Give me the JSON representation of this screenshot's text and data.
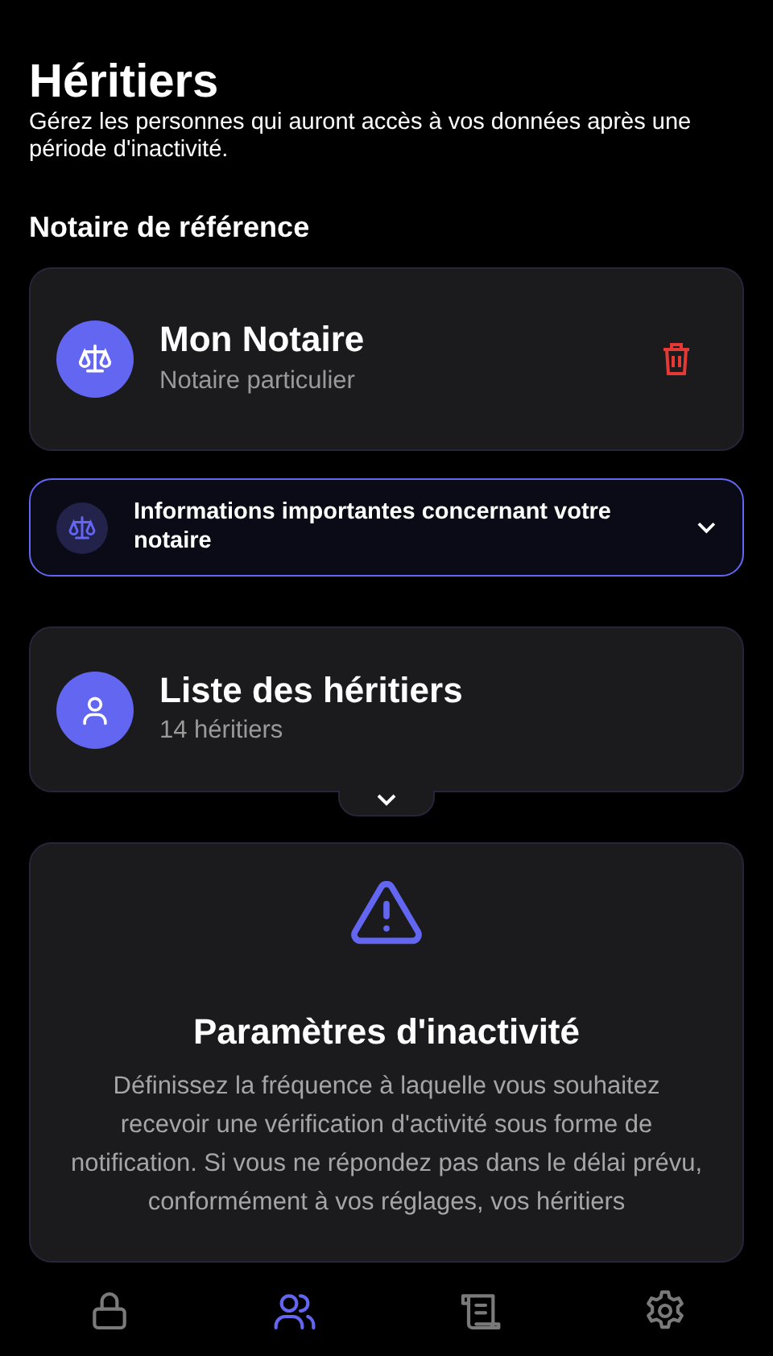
{
  "header": {
    "title": "Héritiers",
    "subtitle": "Gérez les personnes qui auront accès à vos données après une période d'inactivité."
  },
  "notary_section": {
    "heading": "Notaire de référence",
    "name": "Mon Notaire",
    "type": "Notaire particulier"
  },
  "info_panel": {
    "text": "Informations importantes concernant votre notaire",
    "expanded": false
  },
  "heirs_card": {
    "title": "Liste des héritiers",
    "count": "14 héritiers",
    "expanded": false
  },
  "inactivity_card": {
    "title": "Paramètres d'inactivité",
    "text": "Définissez la fréquence à laquelle vous souhaitez recevoir une vérification d'activité sous forme de notification. Si vous ne répondez pas dans le délai prévu, conformément à vos réglages, vos héritiers"
  },
  "tab_bar": [
    {
      "kind": "lock",
      "selected": false
    },
    {
      "kind": "people",
      "selected": true
    },
    {
      "kind": "scroll",
      "selected": false
    },
    {
      "kind": "settings",
      "selected": false
    }
  ]
}
